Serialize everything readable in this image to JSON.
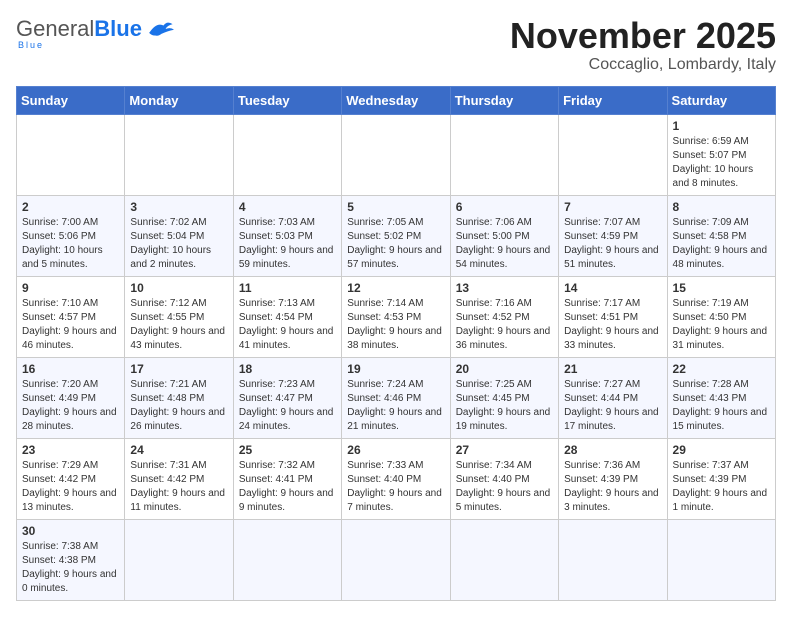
{
  "header": {
    "logo_general": "General",
    "logo_blue": "Blue",
    "logo_sub": "Blue",
    "title": "November 2025",
    "subtitle": "Coccaglio, Lombardy, Italy"
  },
  "weekdays": [
    "Sunday",
    "Monday",
    "Tuesday",
    "Wednesday",
    "Thursday",
    "Friday",
    "Saturday"
  ],
  "weeks": [
    [
      {
        "day": "",
        "info": ""
      },
      {
        "day": "",
        "info": ""
      },
      {
        "day": "",
        "info": ""
      },
      {
        "day": "",
        "info": ""
      },
      {
        "day": "",
        "info": ""
      },
      {
        "day": "",
        "info": ""
      },
      {
        "day": "1",
        "info": "Sunrise: 6:59 AM\nSunset: 5:07 PM\nDaylight: 10 hours and 8 minutes."
      }
    ],
    [
      {
        "day": "2",
        "info": "Sunrise: 7:00 AM\nSunset: 5:06 PM\nDaylight: 10 hours and 5 minutes."
      },
      {
        "day": "3",
        "info": "Sunrise: 7:02 AM\nSunset: 5:04 PM\nDaylight: 10 hours and 2 minutes."
      },
      {
        "day": "4",
        "info": "Sunrise: 7:03 AM\nSunset: 5:03 PM\nDaylight: 9 hours and 59 minutes."
      },
      {
        "day": "5",
        "info": "Sunrise: 7:05 AM\nSunset: 5:02 PM\nDaylight: 9 hours and 57 minutes."
      },
      {
        "day": "6",
        "info": "Sunrise: 7:06 AM\nSunset: 5:00 PM\nDaylight: 9 hours and 54 minutes."
      },
      {
        "day": "7",
        "info": "Sunrise: 7:07 AM\nSunset: 4:59 PM\nDaylight: 9 hours and 51 minutes."
      },
      {
        "day": "8",
        "info": "Sunrise: 7:09 AM\nSunset: 4:58 PM\nDaylight: 9 hours and 48 minutes."
      }
    ],
    [
      {
        "day": "9",
        "info": "Sunrise: 7:10 AM\nSunset: 4:57 PM\nDaylight: 9 hours and 46 minutes."
      },
      {
        "day": "10",
        "info": "Sunrise: 7:12 AM\nSunset: 4:55 PM\nDaylight: 9 hours and 43 minutes."
      },
      {
        "day": "11",
        "info": "Sunrise: 7:13 AM\nSunset: 4:54 PM\nDaylight: 9 hours and 41 minutes."
      },
      {
        "day": "12",
        "info": "Sunrise: 7:14 AM\nSunset: 4:53 PM\nDaylight: 9 hours and 38 minutes."
      },
      {
        "day": "13",
        "info": "Sunrise: 7:16 AM\nSunset: 4:52 PM\nDaylight: 9 hours and 36 minutes."
      },
      {
        "day": "14",
        "info": "Sunrise: 7:17 AM\nSunset: 4:51 PM\nDaylight: 9 hours and 33 minutes."
      },
      {
        "day": "15",
        "info": "Sunrise: 7:19 AM\nSunset: 4:50 PM\nDaylight: 9 hours and 31 minutes."
      }
    ],
    [
      {
        "day": "16",
        "info": "Sunrise: 7:20 AM\nSunset: 4:49 PM\nDaylight: 9 hours and 28 minutes."
      },
      {
        "day": "17",
        "info": "Sunrise: 7:21 AM\nSunset: 4:48 PM\nDaylight: 9 hours and 26 minutes."
      },
      {
        "day": "18",
        "info": "Sunrise: 7:23 AM\nSunset: 4:47 PM\nDaylight: 9 hours and 24 minutes."
      },
      {
        "day": "19",
        "info": "Sunrise: 7:24 AM\nSunset: 4:46 PM\nDaylight: 9 hours and 21 minutes."
      },
      {
        "day": "20",
        "info": "Sunrise: 7:25 AM\nSunset: 4:45 PM\nDaylight: 9 hours and 19 minutes."
      },
      {
        "day": "21",
        "info": "Sunrise: 7:27 AM\nSunset: 4:44 PM\nDaylight: 9 hours and 17 minutes."
      },
      {
        "day": "22",
        "info": "Sunrise: 7:28 AM\nSunset: 4:43 PM\nDaylight: 9 hours and 15 minutes."
      }
    ],
    [
      {
        "day": "23",
        "info": "Sunrise: 7:29 AM\nSunset: 4:42 PM\nDaylight: 9 hours and 13 minutes."
      },
      {
        "day": "24",
        "info": "Sunrise: 7:31 AM\nSunset: 4:42 PM\nDaylight: 9 hours and 11 minutes."
      },
      {
        "day": "25",
        "info": "Sunrise: 7:32 AM\nSunset: 4:41 PM\nDaylight: 9 hours and 9 minutes."
      },
      {
        "day": "26",
        "info": "Sunrise: 7:33 AM\nSunset: 4:40 PM\nDaylight: 9 hours and 7 minutes."
      },
      {
        "day": "27",
        "info": "Sunrise: 7:34 AM\nSunset: 4:40 PM\nDaylight: 9 hours and 5 minutes."
      },
      {
        "day": "28",
        "info": "Sunrise: 7:36 AM\nSunset: 4:39 PM\nDaylight: 9 hours and 3 minutes."
      },
      {
        "day": "29",
        "info": "Sunrise: 7:37 AM\nSunset: 4:39 PM\nDaylight: 9 hours and 1 minute."
      }
    ],
    [
      {
        "day": "30",
        "info": "Sunrise: 7:38 AM\nSunset: 4:38 PM\nDaylight: 9 hours and 0 minutes."
      },
      {
        "day": "",
        "info": ""
      },
      {
        "day": "",
        "info": ""
      },
      {
        "day": "",
        "info": ""
      },
      {
        "day": "",
        "info": ""
      },
      {
        "day": "",
        "info": ""
      },
      {
        "day": "",
        "info": ""
      }
    ]
  ]
}
